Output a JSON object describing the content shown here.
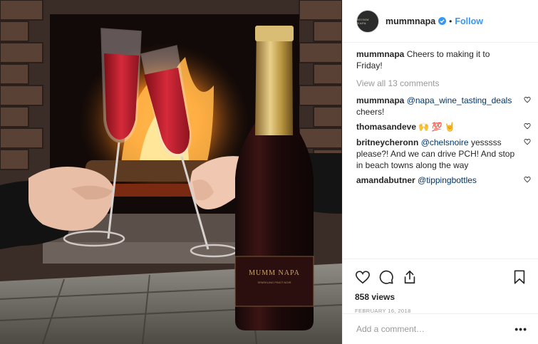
{
  "post": {
    "username": "mummnapa",
    "avatar_text": "MUMM NAPA",
    "follow_label": "Follow",
    "separator": "•",
    "bottle_brand": "MUMM NAPA",
    "bottle_subtitle": "SPARKLING PINOT NOIR"
  },
  "comments": {
    "caption_user": "mummnapa",
    "caption_text": "Cheers to making it to Friday!",
    "view_all": "View all 13 comments",
    "items": [
      {
        "user": "mummnapa",
        "mention": "@napa_wine_tasting_deals",
        "text": "cheers!"
      },
      {
        "user": "thomasandeve",
        "text": "🙌 💯 🤘"
      },
      {
        "user": "britneycheronn",
        "mention": "@chelsnoire",
        "text": "yesssss please?! And we can drive PCH! And stop in beach towns along the way"
      },
      {
        "user": "amandabutner",
        "mention": "@tippingbottles",
        "text": ""
      }
    ]
  },
  "stats": {
    "views": "858 views",
    "date": "FEBRUARY 16, 2018"
  },
  "add_comment": {
    "placeholder": "Add a comment…",
    "more": "•••"
  },
  "colors": {
    "accent": "#3897f0",
    "mention": "#003569",
    "muted": "#999999"
  },
  "icons": [
    "verified-icon",
    "heart-icon",
    "comment-icon",
    "share-icon",
    "bookmark-icon",
    "more-icon"
  ]
}
